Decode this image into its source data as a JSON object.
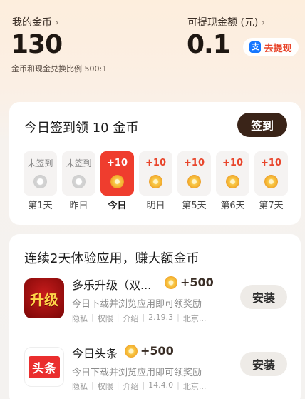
{
  "header": {
    "coins_label": "我的金币",
    "coins_chevron": "›",
    "coins_value": "130",
    "exchange_rate": "金币和现金兑换比例 500:1",
    "cash_label": "可提现金额 (元)",
    "cash_chevron": "›",
    "cash_value": "0.1",
    "withdraw_icon": "支",
    "withdraw_label": "去提现"
  },
  "checkin": {
    "title": "今日签到领 10 金币",
    "button_label": "签到",
    "days": [
      {
        "amount": "未签到",
        "label": "第1天",
        "state": "signed"
      },
      {
        "amount": "未签到",
        "label": "昨日",
        "state": "signed"
      },
      {
        "amount": "+10",
        "label": "今日",
        "state": "today"
      },
      {
        "amount": "+10",
        "label": "明日",
        "state": "future"
      },
      {
        "amount": "+10",
        "label": "第5天",
        "state": "future"
      },
      {
        "amount": "+10",
        "label": "第6天",
        "state": "future"
      },
      {
        "amount": "+10",
        "label": "第7天",
        "state": "future"
      }
    ]
  },
  "apps_section": {
    "title": "连续2天体验应用，赚大额金币",
    "apps": [
      {
        "icon_text": "升级",
        "name": "多乐升级（双...",
        "reward": "+500",
        "description": "今日下载并浏览应用即可领奖励",
        "meta": [
          "隐私",
          "权限",
          "介绍",
          "2.19.3",
          "北京..."
        ],
        "install_label": "安装"
      },
      {
        "icon_text": "头条",
        "name": "今日头条",
        "reward": "+500",
        "description": "今日下载并浏览应用即可领奖励",
        "meta": [
          "隐私",
          "权限",
          "介绍",
          "14.4.0",
          "北京..."
        ],
        "install_label": "安装"
      }
    ]
  }
}
